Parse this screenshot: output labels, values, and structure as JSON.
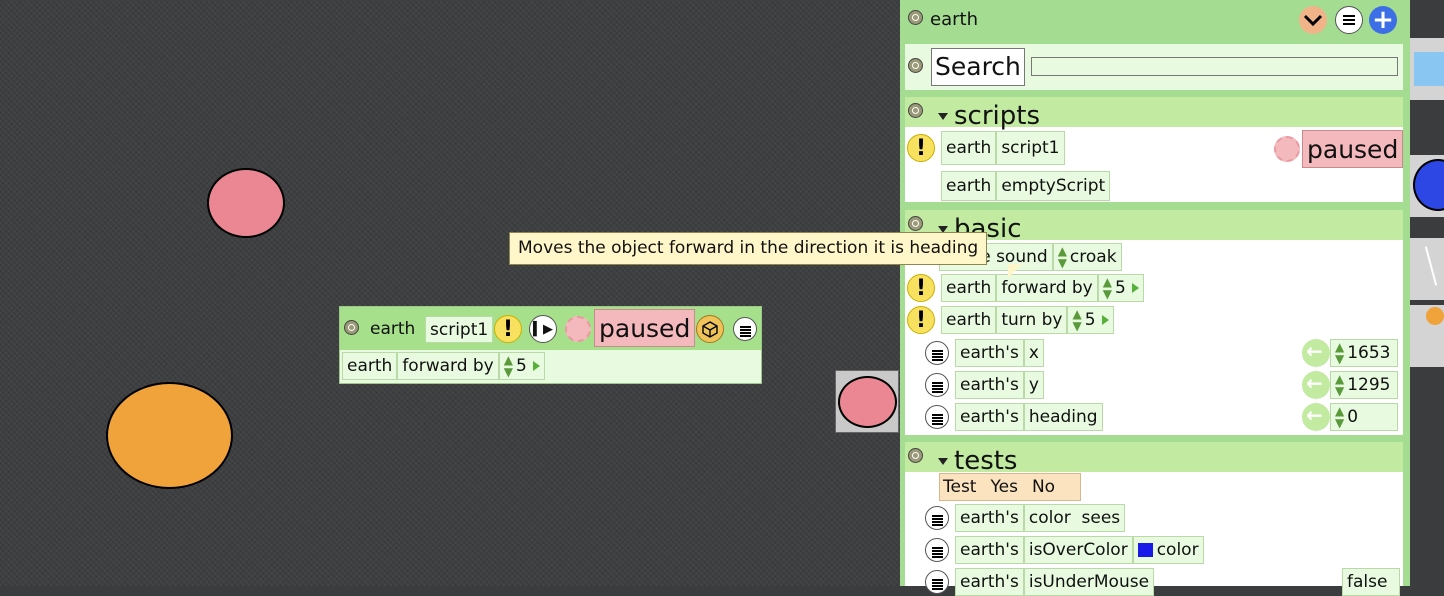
{
  "colors": {
    "world_bg": "#3c3d3f",
    "viewer_bg": "#a4dd92",
    "tile_bg": "#e8fbe0",
    "paused_bg": "#f4b9bd",
    "pink_ellipse": "#ea8793",
    "orange_ellipse": "#f0a23b",
    "blue_swatch": "#1a1ae8"
  },
  "tooltip": "Moves the object forward in the direction it is heading",
  "script_editor": {
    "object": "earth",
    "script_name": "script1",
    "status": "paused",
    "command": {
      "object": "earth",
      "label": "forward by",
      "value": "5"
    }
  },
  "viewer": {
    "title": "earth",
    "search_label": "Search",
    "search_value": "",
    "sections": {
      "scripts": {
        "title": "scripts",
        "rows": [
          {
            "object": "earth",
            "name": "script1",
            "status": "paused"
          },
          {
            "object": "earth",
            "name": "emptyScript"
          }
        ]
      },
      "basic": {
        "title": "basic",
        "make_sound": {
          "label": "make sound",
          "value": "croak"
        },
        "commands": [
          {
            "object": "earth",
            "label": "forward by",
            "value": "5"
          },
          {
            "object": "earth",
            "label": "turn by",
            "value": "5"
          }
        ],
        "vars": [
          {
            "owner": "earth's",
            "name": "x",
            "value": "1653"
          },
          {
            "owner": "earth's",
            "name": "y",
            "value": "1295"
          },
          {
            "owner": "earth's",
            "name": "heading",
            "value": "0"
          }
        ]
      },
      "tests": {
        "title": "tests",
        "test_tile": {
          "test": "Test",
          "yes": "Yes",
          "no": "No"
        },
        "rows": [
          {
            "owner": "earth's",
            "name": "color  sees"
          },
          {
            "owner": "earth's",
            "name": "isOverColor",
            "arg": "color"
          },
          {
            "owner": "earth's",
            "name": "isUnderMouse",
            "value": "false"
          }
        ]
      }
    }
  }
}
